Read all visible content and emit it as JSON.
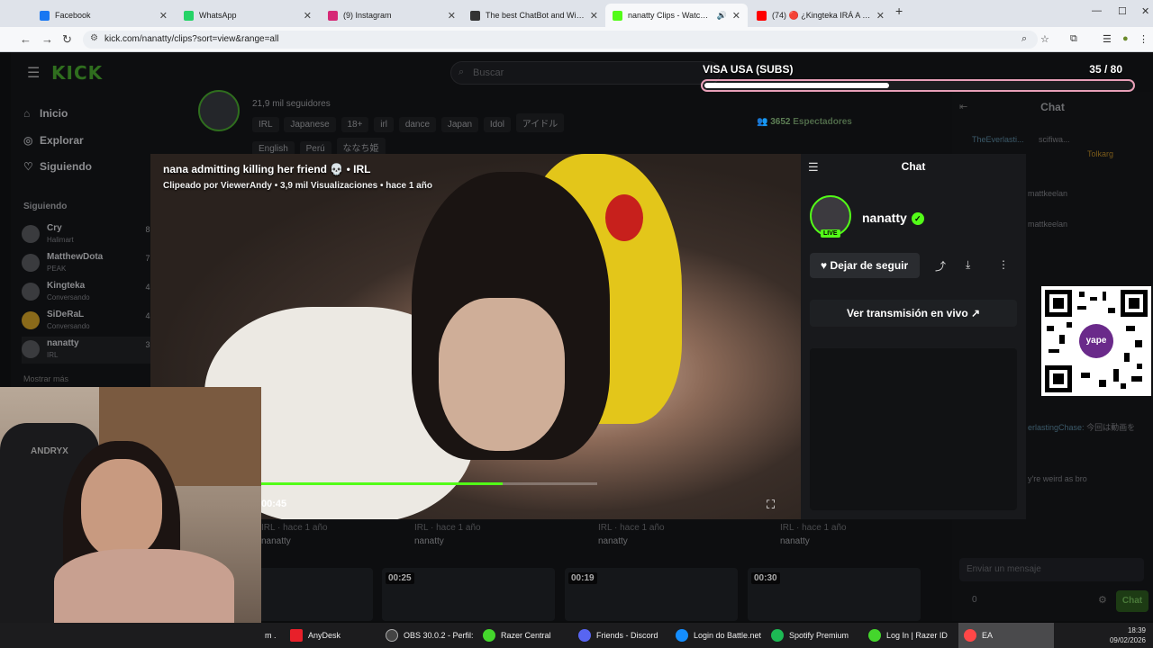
{
  "browser": {
    "tabs": [
      {
        "label": "Facebook",
        "color": "#1877f2"
      },
      {
        "label": "WhatsApp",
        "color": "#25d366"
      },
      {
        "label": "(9) Instagram",
        "color": "#d62976"
      },
      {
        "label": "The best ChatBot and Widgets",
        "color": "#333333"
      },
      {
        "label": "nanatty Clips - Watch Live o",
        "color": "#53fc18"
      },
      {
        "label": "(74) 🔴 ¿Kingteka IRÁ A CANAL",
        "color": "#ff0000"
      }
    ],
    "url": "kick.com/nanatty/clips?sort=view&range=all"
  },
  "kick": {
    "logo": "KICK",
    "search_placeholder": "Buscar",
    "nav": {
      "home": "Inicio",
      "explore": "Explorar",
      "following": "Siguiendo"
    },
    "sidebar_heading": "Siguiendo",
    "channels": [
      {
        "name": "Cry",
        "category": "Halimart",
        "viewers": "8,5"
      },
      {
        "name": "MatthewDota",
        "category": "PEAK",
        "viewers": "7,5"
      },
      {
        "name": "Kingteka",
        "category": "Conversando",
        "viewers": "4,8"
      },
      {
        "name": "SiDeRaL",
        "category": "Conversando",
        "viewers": "4,4"
      },
      {
        "name": "nanatty",
        "category": "IRL",
        "viewers": "3,7"
      }
    ],
    "show_more": "Mostrar más",
    "followers": "21,9 mil seguidores",
    "tags": [
      "IRL",
      "Japanese",
      "18+",
      "irl",
      "dance",
      "Japan",
      "Idol",
      "アイドル",
      "English",
      "Perú",
      "ななち姫"
    ],
    "spectators_count": "3652",
    "spectators_label": "Espectadores",
    "grid_meta": [
      {
        "time": "IRL · hace 1 año",
        "user": "nanatty"
      },
      {
        "time": "IRL · hace 1 año",
        "user": "nanatty"
      },
      {
        "time": "IRL · hace 1 año",
        "user": "nanatty"
      },
      {
        "time": "IRL · hace 1 año",
        "user": "nanatty"
      }
    ],
    "grid_durations": [
      "",
      "00:25",
      "00:19",
      "00:30"
    ]
  },
  "clip": {
    "title": "nana admitting killing her friend 💀 • IRL",
    "subtitle": "Clipeado por ViewerAndy • 3,9 mil Visualizaciones • hace 1 año",
    "time": "00:45",
    "progress": 0.72,
    "panel": {
      "title": "Chat",
      "channel": "nanatty",
      "live": "LIVE",
      "unfollow": "Dejar de seguir",
      "watch_live": "Ver transmisión en vivo"
    }
  },
  "stream_chat": {
    "title": "Chat",
    "messages": [
      {
        "user": "TheEverlasti...",
        "text": "scifiwa..."
      },
      {
        "user": "",
        "text": "Tolkarg"
      },
      {
        "user": "",
        "text": "mattkeelan"
      },
      {
        "user": "",
        "text": "mattkeelan"
      },
      {
        "user": "erlastingChase:",
        "text": "今回は動画を"
      },
      {
        "user": "",
        "text": "y're weird as bro"
      }
    ],
    "input_placeholder": "Enviar un mensaje",
    "send": "Chat",
    "count": "0"
  },
  "overlay": {
    "goal_title": "VISA USA (SUBS)",
    "goal_count": "35 / 80",
    "goal_fraction": 0.4375,
    "qr_brand": "yape",
    "webcam_brand": "ANDRYX"
  },
  "taskbar": {
    "items": [
      {
        "label": "AnyDesk",
        "color": "#e8202a"
      },
      {
        "label": "OBS 30.0.2 - Perfil: ...",
        "color": "#444444"
      },
      {
        "label": "Razer Central",
        "color": "#44d62c"
      },
      {
        "label": "Friends - Discord",
        "color": "#5865f2"
      },
      {
        "label": "Login do Battle.net",
        "color": "#148eff"
      },
      {
        "label": "Spotify Premium",
        "color": "#1db954"
      },
      {
        "label": "Log In | Razer ID",
        "color": "#44d62c"
      },
      {
        "label": "EA",
        "color": "#ff4747"
      }
    ],
    "time": "18:39",
    "date": "09/02/2026"
  }
}
